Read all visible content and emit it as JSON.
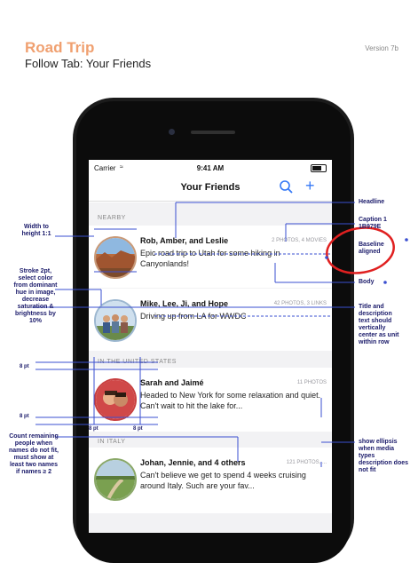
{
  "doc": {
    "title": "Road Trip",
    "subtitle": "Follow Tab: Your Friends",
    "version": "Version 7b"
  },
  "status_bar": {
    "carrier": "Carrier",
    "wifi_icon": "wifi-icon",
    "time": "9:41 AM",
    "battery_icon": "battery-icon"
  },
  "nav": {
    "title": "Your Friends",
    "search_icon": "search-icon",
    "add_label": "+"
  },
  "sections": [
    {
      "header": "NEARBY",
      "rows": [
        {
          "names": "Rob, Amber, and Leslie",
          "caption": "2 PHOTOS, 4 MOVIES",
          "body": "Epic road trip to Utah for some hiking in Canyonlands!",
          "avatar": "canyon-photo"
        },
        {
          "names": "Mike, Lee, Ji, and Hope",
          "caption": "42 PHOTOS, 3 LINKS",
          "body": "Driving up from LA for WWDC",
          "avatar": "group-photo"
        }
      ]
    },
    {
      "header": "IN THE UNITED STATES",
      "rows": [
        {
          "names": "Sarah and Jaimé",
          "caption": "11 PHOTOS",
          "body": "Headed to New York for some relaxation and quiet. Can't wait to hit the lake for...",
          "avatar": "couple-photo"
        }
      ]
    },
    {
      "header": "IN ITALY",
      "rows": [
        {
          "names": "Johan, Jennie, and 4 others",
          "caption": "121 PHOTOS, ...",
          "body": "Can't believe we get to spend 4 weeks cruising around Italy. Such are your fav...",
          "avatar": "italy-photo"
        }
      ]
    }
  ],
  "annotations": {
    "left": {
      "width_height": "Width to height 1:1",
      "stroke": "Stroke 2pt, select color from dominant hue in image, decrease saturation & brightness by 10%",
      "pt_top": "8 pt",
      "pt_bottom": "8 pt",
      "pt_under_avatar_1": "8 pt",
      "pt_under_avatar_2": "8 pt",
      "count": "Count remaining people when names do not fit, must show at least two names if names ≥ 2"
    },
    "right": {
      "headline": "Headline",
      "caption": "Caption 1 1B979E",
      "baseline": "Baseline aligned",
      "body": "Body",
      "title_desc": "Title and description text should vertically center as unit within row",
      "ellipsis": "show ellipsis when media types description does not fit"
    }
  },
  "colors": {
    "title_accent": "#f0a070",
    "annotation_line": "#3a4fd0",
    "annotation_text": "#1a1a6a",
    "highlight_circle": "#e02020",
    "action_blue": "#3478f6"
  }
}
